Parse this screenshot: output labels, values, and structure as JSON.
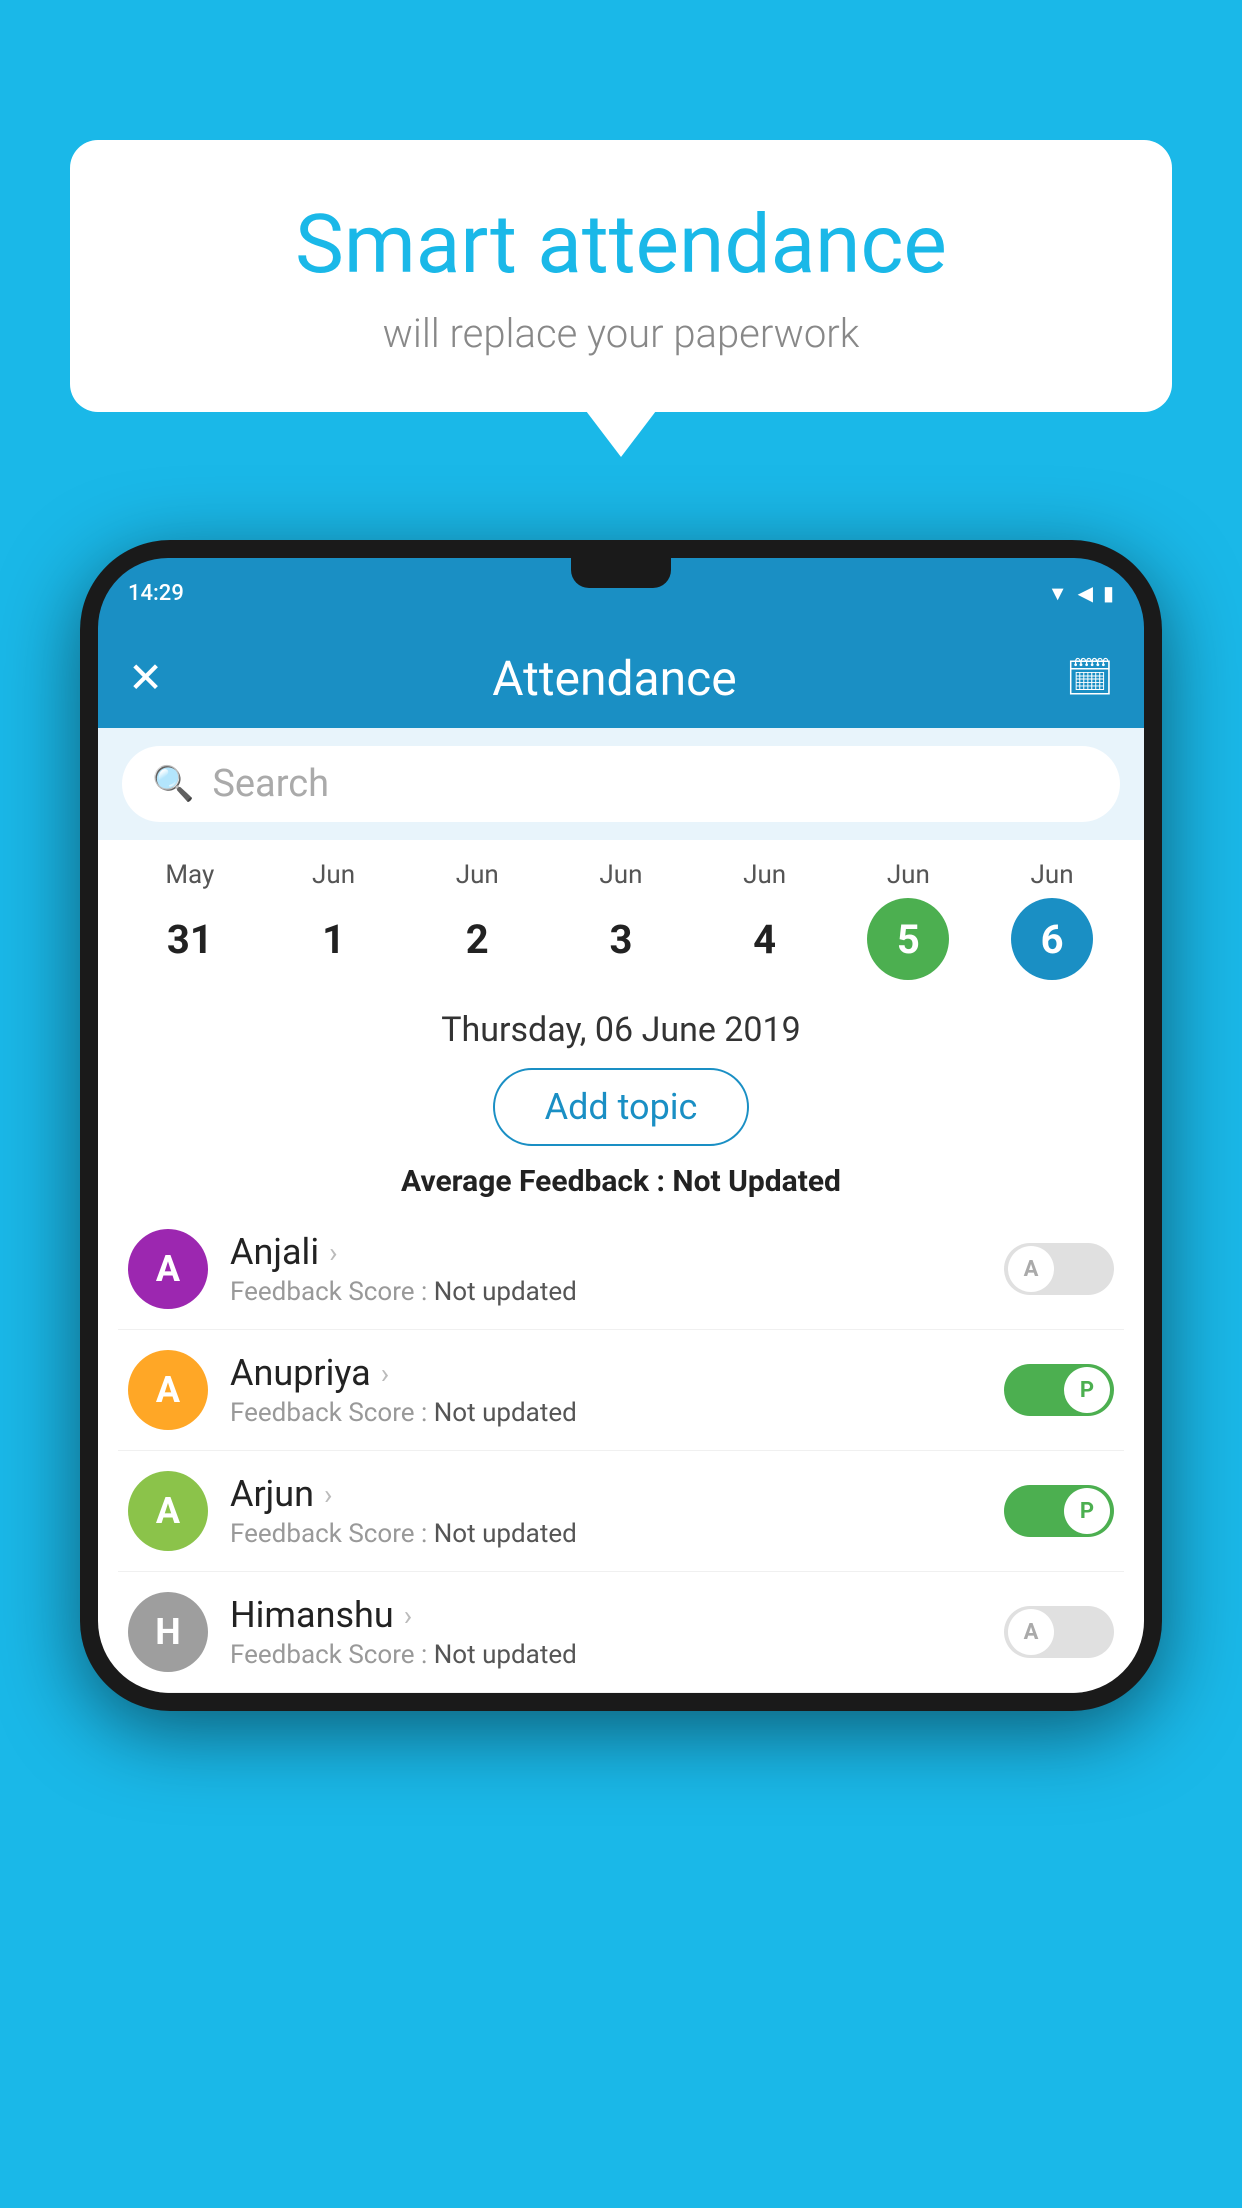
{
  "background": {
    "color": "#1ab8e8"
  },
  "speech_bubble": {
    "title": "Smart attendance",
    "subtitle": "will replace your paperwork"
  },
  "status_bar": {
    "time": "14:29",
    "wifi_icon": "▲",
    "signal_icon": "▲",
    "battery_icon": "▮"
  },
  "app_bar": {
    "title": "Attendance",
    "close_icon": "✕",
    "calendar_icon": "📅"
  },
  "search": {
    "placeholder": "Search"
  },
  "calendar": {
    "days": [
      {
        "month": "May",
        "date": "31",
        "state": "normal"
      },
      {
        "month": "Jun",
        "date": "1",
        "state": "normal"
      },
      {
        "month": "Jun",
        "date": "2",
        "state": "normal"
      },
      {
        "month": "Jun",
        "date": "3",
        "state": "normal"
      },
      {
        "month": "Jun",
        "date": "4",
        "state": "normal"
      },
      {
        "month": "Jun",
        "date": "5",
        "state": "today"
      },
      {
        "month": "Jun",
        "date": "6",
        "state": "selected"
      }
    ]
  },
  "selected_date": {
    "text": "Thursday, 06 June 2019",
    "add_topic_label": "Add topic",
    "avg_feedback_label": "Average Feedback : ",
    "avg_feedback_value": "Not Updated"
  },
  "students": [
    {
      "name": "Anjali",
      "avatar_letter": "A",
      "avatar_color": "#9c27b0",
      "feedback_label": "Feedback Score : ",
      "feedback_value": "Not updated",
      "toggle_state": "off",
      "toggle_label": "A"
    },
    {
      "name": "Anupriya",
      "avatar_letter": "A",
      "avatar_color": "#ffa726",
      "feedback_label": "Feedback Score : ",
      "feedback_value": "Not updated",
      "toggle_state": "on",
      "toggle_label": "P"
    },
    {
      "name": "Arjun",
      "avatar_letter": "A",
      "avatar_color": "#8bc34a",
      "feedback_label": "Feedback Score : ",
      "feedback_value": "Not updated",
      "toggle_state": "on",
      "toggle_label": "P"
    },
    {
      "name": "Himanshu",
      "avatar_letter": "H",
      "avatar_color": "#9e9e9e",
      "feedback_label": "Feedback Score : ",
      "feedback_value": "Not updated",
      "toggle_state": "off",
      "toggle_label": "A"
    }
  ]
}
